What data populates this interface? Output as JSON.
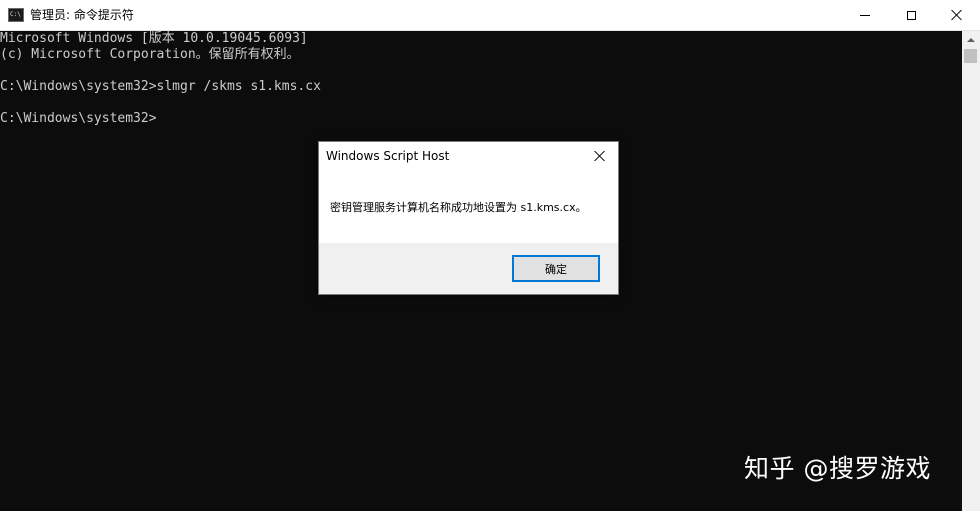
{
  "window": {
    "title": "管理员: 命令提示符",
    "icon": "cmd-icon"
  },
  "console": {
    "lines": [
      "Microsoft Windows [版本 10.0.19045.6093]",
      "(c) Microsoft Corporation。保留所有权利。",
      "",
      "C:\\Windows\\system32>slmgr /skms s1.kms.cx",
      "",
      "C:\\Windows\\system32>"
    ]
  },
  "dialog": {
    "title": "Windows Script Host",
    "message": "密钥管理服务计算机名称成功地设置为 s1.kms.cx。",
    "ok_label": "确定"
  },
  "watermark": {
    "text": "知乎 @搜罗游戏"
  },
  "colors": {
    "console_bg": "#0c0c0c",
    "console_text": "#cccccc",
    "accent": "#0078d7"
  }
}
